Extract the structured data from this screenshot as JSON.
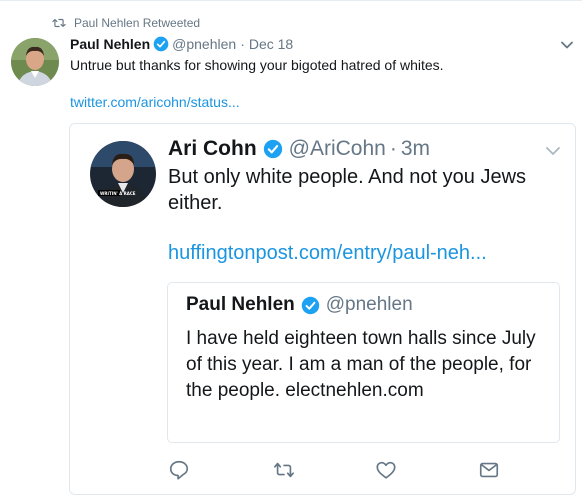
{
  "retweet": {
    "label": "Paul Nehlen Retweeted"
  },
  "tweet": {
    "name": "Paul Nehlen",
    "handle": "@pnehlen",
    "separator": "·",
    "date": "Dec 18",
    "text": "Untrue but thanks for showing your bigoted hatred of whites.",
    "link": "twitter.com/aricohn/status..."
  },
  "quote": {
    "name": "Ari Cohn",
    "handle": "@AriCohn",
    "separator": "·",
    "time": "3m",
    "text": "But only white people. And not you Jews either.",
    "link": "huffingtonpost.com/entry/paul-neh...",
    "avatar_overlay": "WRITIN' A RACE",
    "inner": {
      "name": "Paul Nehlen",
      "handle": "@pnehlen",
      "text": "I have held eighteen town halls since July of this year. I am a man of the people, for the people. electnehlen.com"
    }
  },
  "actions": [
    "reply-icon",
    "retweet-icon",
    "like-icon",
    "direct-message-icon"
  ],
  "colors": {
    "link": "#1b95e0",
    "secondary_text": "#657786",
    "verified": "#1da1f2",
    "border": "#e1e8ed"
  }
}
